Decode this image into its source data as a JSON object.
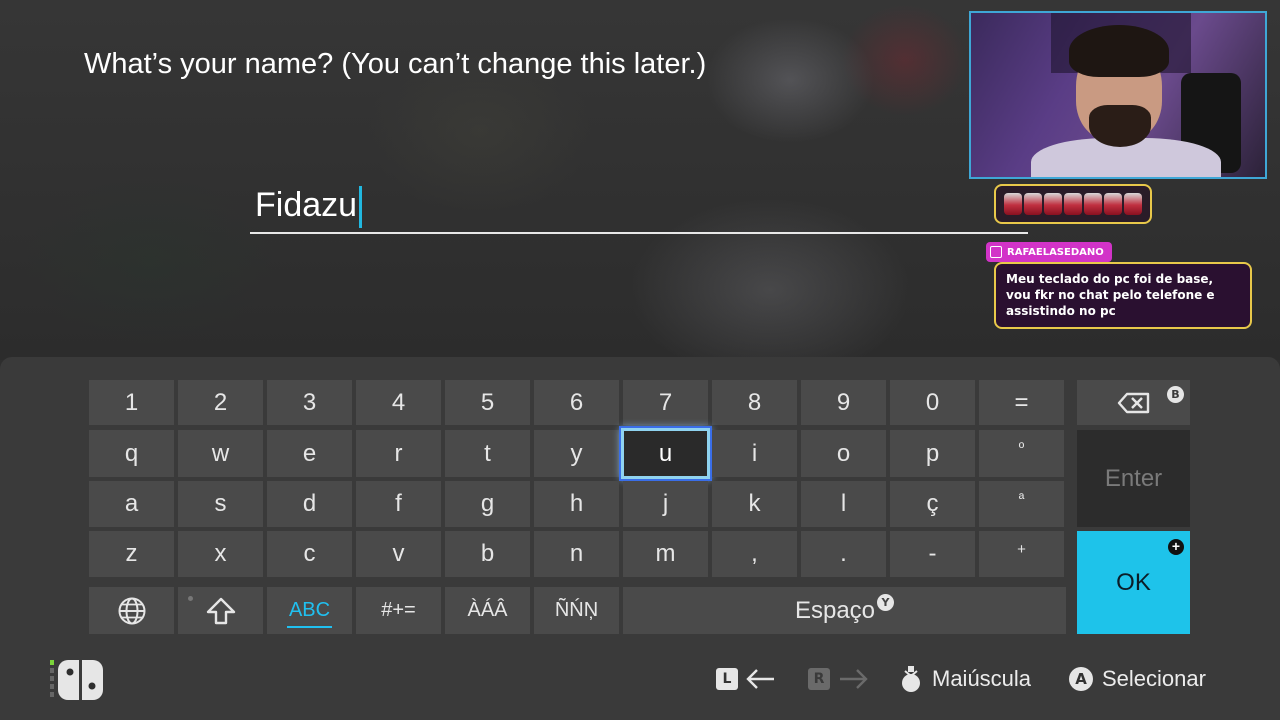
{
  "prompt": {
    "title": "What’s your name? (You can’t change this later.)",
    "input_value": "Fidazu"
  },
  "overlay": {
    "chat_username": "RAFAELASEDANO",
    "chat_message": "Meu teclado do pc foi de base, vou fkr no chat pelo telefone e assistindo no pc"
  },
  "keyboard": {
    "row_numbers": [
      "1",
      "2",
      "3",
      "4",
      "5",
      "6",
      "7",
      "8",
      "9",
      "0",
      "="
    ],
    "row_q": [
      "q",
      "w",
      "e",
      "r",
      "t",
      "y",
      "u",
      "i",
      "o",
      "p",
      "º"
    ],
    "row_a": [
      "a",
      "s",
      "d",
      "f",
      "g",
      "h",
      "j",
      "k",
      "l",
      "ç",
      "ª"
    ],
    "row_z": [
      "z",
      "x",
      "c",
      "v",
      "b",
      "n",
      "m",
      ",",
      ".",
      "-",
      "+"
    ],
    "selected_key": "u",
    "mode_abc": "ABC",
    "mode_symbols": "#+=",
    "mode_accents_a": "ÀÁÂ",
    "mode_accents_n": "ÑŃŅ",
    "space_label": "Espaço",
    "space_hint": "Y",
    "backspace_hint": "B",
    "enter_label": "Enter",
    "ok_label": "OK",
    "ok_hint": "+"
  },
  "footer": {
    "l_button": "L",
    "r_button": "R",
    "caps_label": "Maiúscula",
    "a_button": "A",
    "select_label": "Selecionar"
  },
  "colors": {
    "accent": "#1ec3ea",
    "caret": "#21b8e0",
    "panel": "#3a3a3a",
    "key": "#4a4a4a"
  }
}
